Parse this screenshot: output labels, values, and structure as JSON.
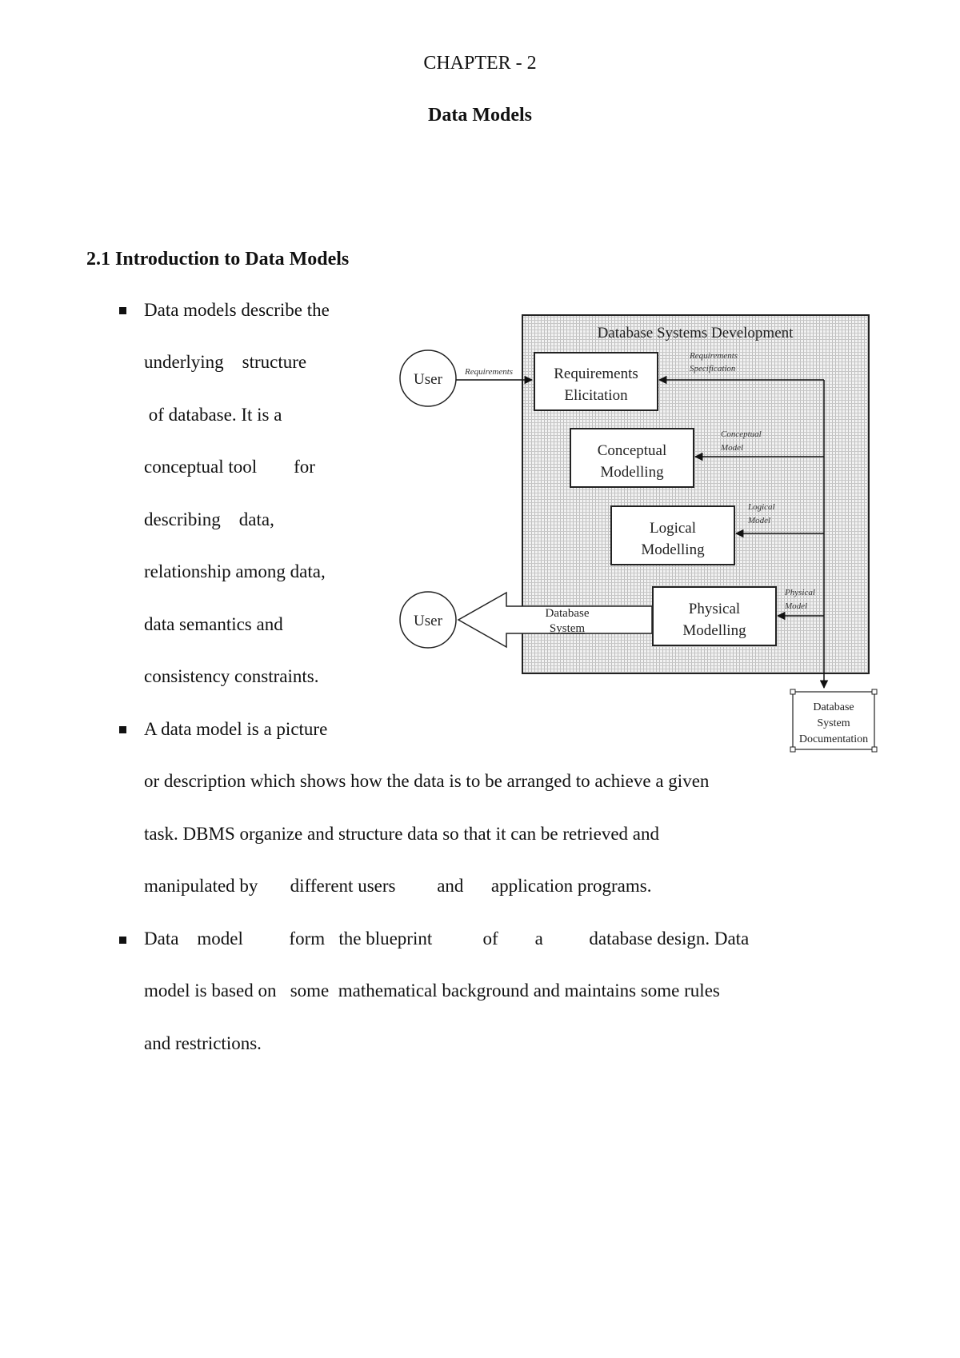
{
  "header": {
    "chapter": "CHAPTER - 2",
    "title": "Data Models"
  },
  "section": {
    "heading": "2.1 Introduction to Data Models"
  },
  "body_lines": [
    "Data models describe the",
    "underlying    structure",
    " of database. It is a",
    "conceptual tool        for",
    "describing    data,",
    "relationship among data,",
    "data semantics and",
    "consistency constraints.",
    "A data model is a picture",
    "or description which shows how the data is to be arranged to achieve a given",
    "task. DBMS organize and structure data so that it can be retrieved and",
    "manipulated by       different users         and      application programs.",
    "Data    model          form   the blueprint           of        a          database design. Data",
    "model is based on   some  mathematical background and maintains some rules",
    "and restrictions."
  ],
  "bullets_at_lines": [
    0,
    8,
    12
  ],
  "diagram": {
    "title": "Database Systems Development",
    "user_label": "User",
    "user_bottom_label": "User",
    "requirements_edge": "Requirements",
    "boxes": {
      "requirements": [
        "Requirements",
        "Elicitation"
      ],
      "conceptual": [
        "Conceptual",
        "Modelling"
      ],
      "logical": [
        "Logical",
        "Modelling"
      ],
      "physical": [
        "Physical",
        "Modelling"
      ]
    },
    "edge_labels": {
      "req_spec": [
        "Requirements",
        "Specification"
      ],
      "conceptual": [
        "Conceptual",
        "Model"
      ],
      "logical": [
        "Logical",
        "Model"
      ],
      "physical": [
        "Physical",
        "Model"
      ]
    },
    "output_arrow": [
      "Database",
      "System"
    ],
    "documentation": [
      "Database",
      "System",
      "Documentation"
    ]
  }
}
